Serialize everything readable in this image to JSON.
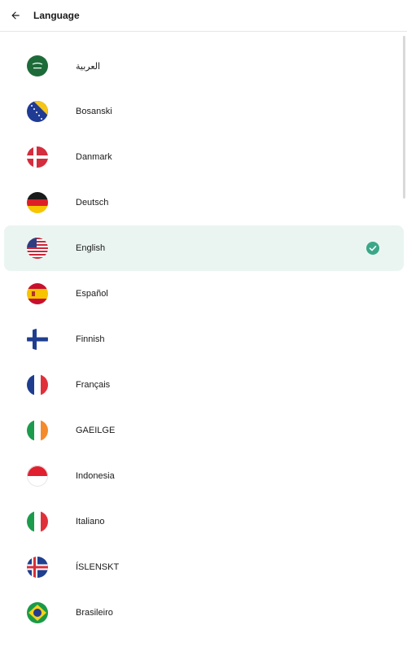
{
  "header": {
    "title": "Language",
    "back_icon": "arrow-left-icon"
  },
  "languages": [
    {
      "label": "العربية",
      "flag": "saudi-arabia-flag-icon",
      "selected": false
    },
    {
      "label": "Bosanski",
      "flag": "bosnia-flag-icon",
      "selected": false
    },
    {
      "label": "Danmark",
      "flag": "denmark-flag-icon",
      "selected": false
    },
    {
      "label": "Deutsch",
      "flag": "germany-flag-icon",
      "selected": false
    },
    {
      "label": "English",
      "flag": "usa-flag-icon",
      "selected": true
    },
    {
      "label": "Español",
      "flag": "spain-flag-icon",
      "selected": false
    },
    {
      "label": "Finnish",
      "flag": "finland-flag-icon",
      "selected": false
    },
    {
      "label": "Français",
      "flag": "france-flag-icon",
      "selected": false
    },
    {
      "label": "GAEILGE",
      "flag": "ireland-flag-icon",
      "selected": false
    },
    {
      "label": "Indonesia",
      "flag": "indonesia-flag-icon",
      "selected": false
    },
    {
      "label": "Italiano",
      "flag": "italy-flag-icon",
      "selected": false
    },
    {
      "label": "ÍSLENSKT",
      "flag": "iceland-flag-icon",
      "selected": false
    },
    {
      "label": "Brasileiro",
      "flag": "brazil-flag-icon",
      "selected": false
    }
  ],
  "colors": {
    "accent": "#2e9c78",
    "selected_bg": "#eaf5f1"
  }
}
